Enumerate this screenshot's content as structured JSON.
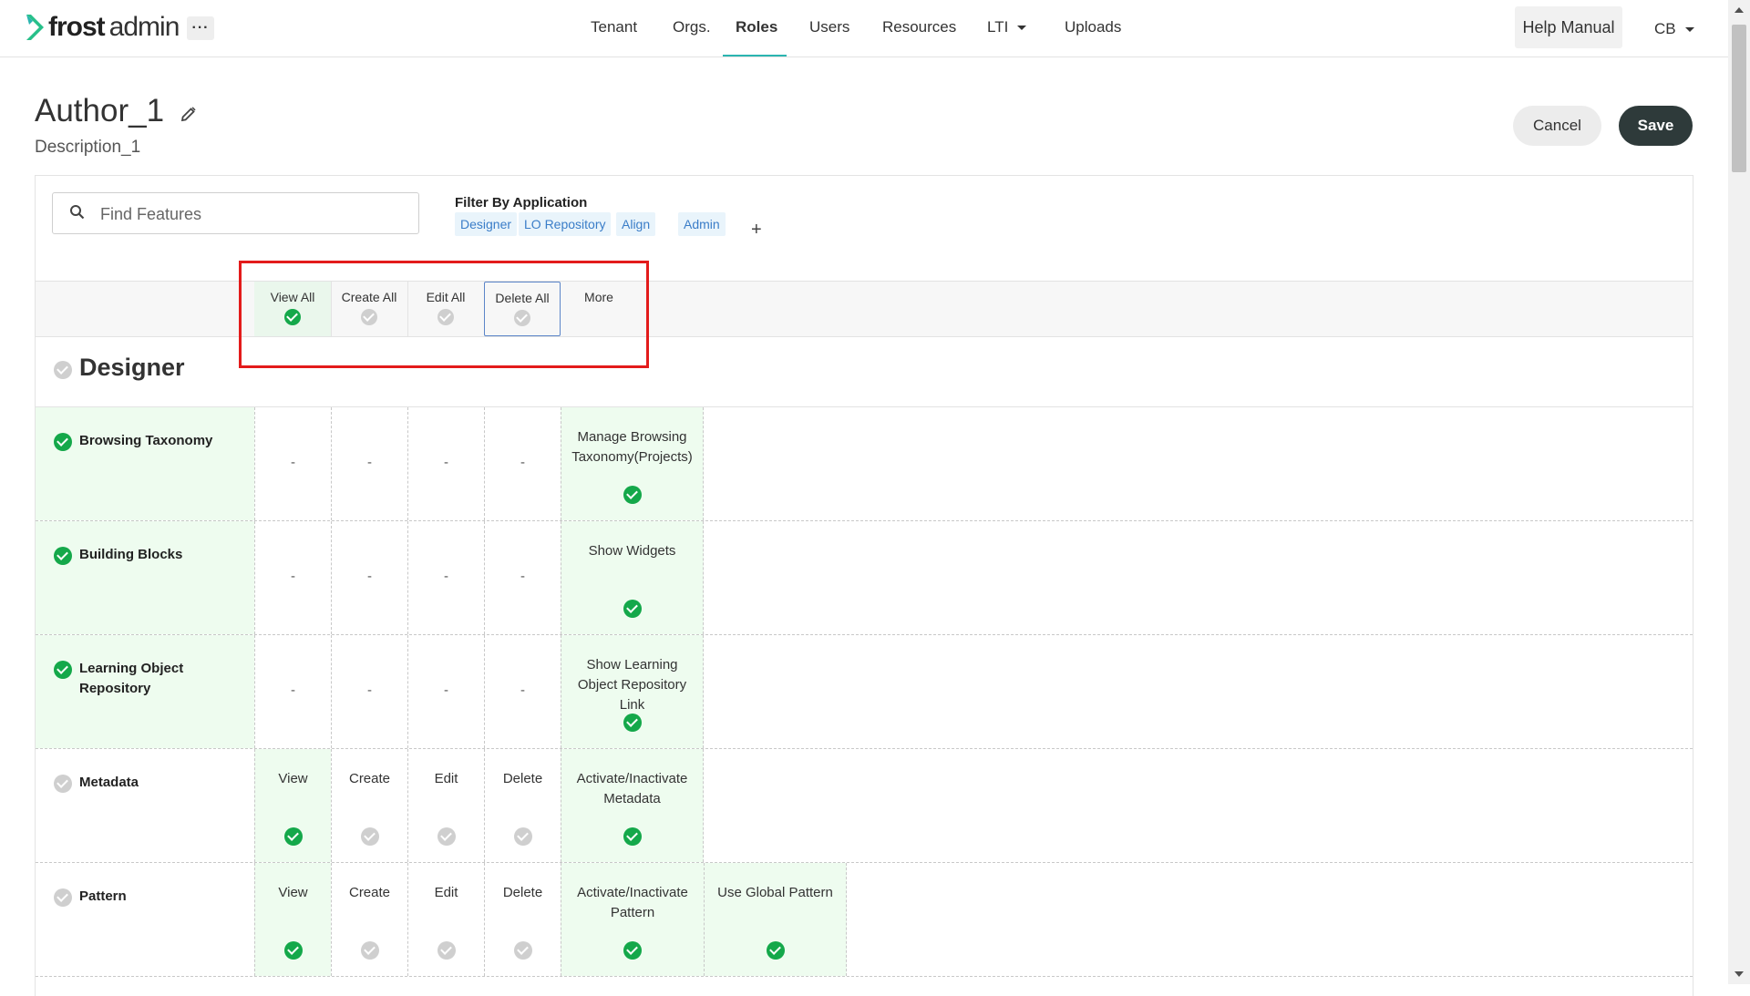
{
  "brand": {
    "name": "frost",
    "sub": "admin"
  },
  "nav": {
    "items": [
      {
        "label": "Tenant"
      },
      {
        "label": "Orgs."
      },
      {
        "label": "Roles"
      },
      {
        "label": "Users"
      },
      {
        "label": "Resources"
      },
      {
        "label": "LTI"
      },
      {
        "label": "Uploads"
      }
    ],
    "active": "Roles",
    "more_label": "···",
    "help_label": "Help Manual",
    "user_initials": "CB"
  },
  "role": {
    "title": "Author_1",
    "description": "Description_1"
  },
  "actions": {
    "cancel_label": "Cancel",
    "save_label": "Save"
  },
  "search": {
    "placeholder": "Find Features",
    "value": ""
  },
  "filter": {
    "label": "Filter By Application",
    "chips": [
      "Designer",
      "LO Repository",
      "Align",
      "Admin"
    ],
    "add_label": "+"
  },
  "matrix_header": [
    {
      "label": "View All",
      "checked": true
    },
    {
      "label": "Create All",
      "checked": false
    },
    {
      "label": "Edit All",
      "checked": false
    },
    {
      "label": "Delete All",
      "checked": false
    },
    {
      "label": "More"
    }
  ],
  "section": {
    "title": "Designer",
    "checked": false
  },
  "features": [
    {
      "name": "Browsing Taxonomy",
      "checked": true,
      "view": "-",
      "create": "-",
      "edit": "-",
      "delete": "-",
      "more": [
        {
          "label": "Manage Browsing Taxonomy(Projects)",
          "checked": true
        }
      ]
    },
    {
      "name": "Building Blocks",
      "checked": true,
      "view": "-",
      "create": "-",
      "edit": "-",
      "delete": "-",
      "more": [
        {
          "label": "Show Widgets",
          "checked": true
        }
      ]
    },
    {
      "name": "Learning Object Repository",
      "checked": true,
      "view": "-",
      "create": "-",
      "edit": "-",
      "delete": "-",
      "more": [
        {
          "label": "Show Learning Object Repository Link",
          "checked": true
        }
      ]
    },
    {
      "name": "Metadata",
      "checked": false,
      "view": "View",
      "create": "Create",
      "edit": "Edit",
      "delete": "Delete",
      "view_checked": true,
      "create_checked": false,
      "edit_checked": false,
      "delete_checked": false,
      "more": [
        {
          "label": "Activate/Inactivate Metadata",
          "checked": true
        }
      ]
    },
    {
      "name": "Pattern",
      "checked": false,
      "view": "View",
      "create": "Create",
      "edit": "Edit",
      "delete": "Delete",
      "view_checked": true,
      "create_checked": false,
      "edit_checked": false,
      "delete_checked": false,
      "more": [
        {
          "label": "Activate/Inactivate Pattern",
          "checked": true
        },
        {
          "label": "Use Global Pattern",
          "checked": true
        }
      ]
    }
  ],
  "colors": {
    "accent": "#2bb5b0",
    "check_on": "#14a84a",
    "check_off": "#cfcfcf",
    "enabled_cell": "#eefcef",
    "chip_bg": "#e9f4fb",
    "chip_text": "#3a7dc8",
    "save_bg": "#2e3a3a",
    "annotation_box": "#e31b1b"
  }
}
